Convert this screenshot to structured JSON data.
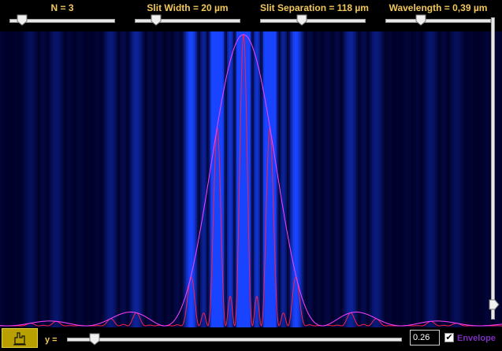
{
  "sliders": [
    {
      "id": "n",
      "label": "N = 3",
      "value_fraction": 0.1
    },
    {
      "id": "slit-width",
      "label": "Slit Width = 20 µm",
      "value_fraction": 0.2
    },
    {
      "id": "slit-separation",
      "label": "Slit Separation = 118 µm",
      "value_fraction": 0.4
    },
    {
      "id": "wavelength",
      "label": "Wavelength = 0,39 µm",
      "value_fraction": 0.35
    }
  ],
  "physics": {
    "N": 3,
    "slit_width_um": 20,
    "slit_separation_um": 118,
    "wavelength_um": 0.39
  },
  "vertical_slider": {
    "value_fraction": 0.07
  },
  "bottom": {
    "y_label": "y =",
    "y_value": "0.26",
    "y_fraction": 0.07,
    "envelope_checked": true,
    "envelope_label": "Envelope",
    "checkbox_mark": "✔"
  },
  "icons": {
    "reset": "reset-hand-icon"
  },
  "colors": {
    "label": "#f2c85a",
    "pattern": "#1844ff",
    "intensity_curve": "#ff2040",
    "envelope_curve": "#ff40ff",
    "envelope_label": "#7b2fbe",
    "reset_button": "#b8a000"
  }
}
